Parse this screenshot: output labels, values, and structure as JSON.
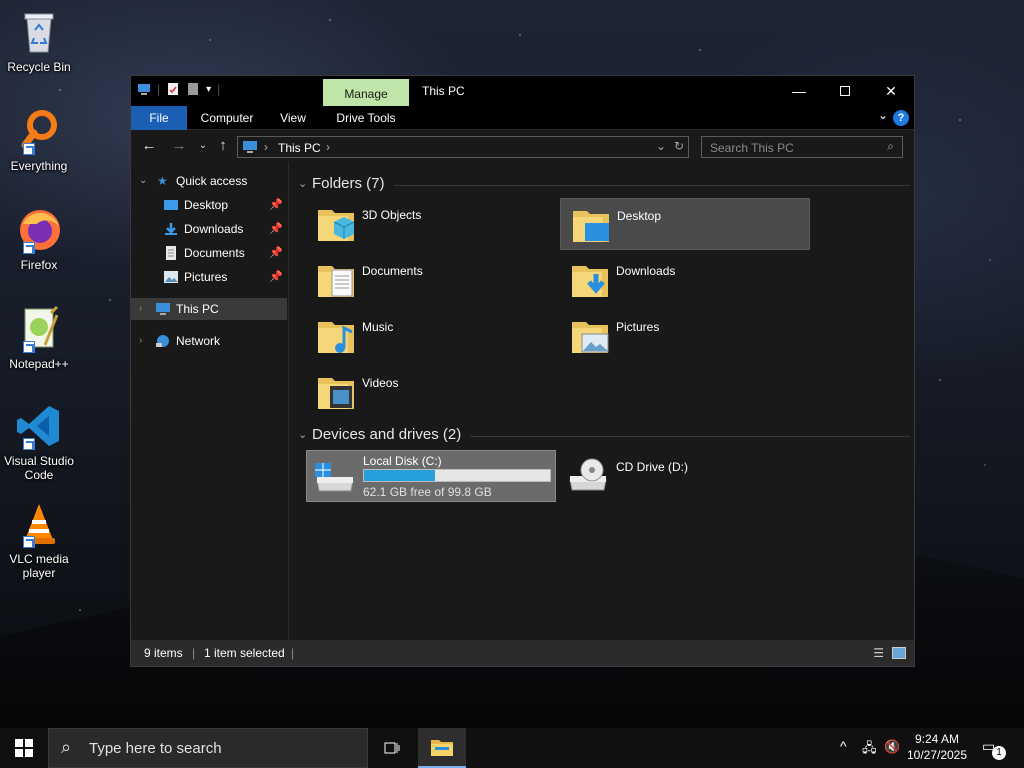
{
  "desktop": {
    "icons": [
      {
        "label": "Recycle Bin",
        "icon": "recycle-bin-icon"
      },
      {
        "label": "Everything",
        "icon": "everything-search-icon"
      },
      {
        "label": "Firefox",
        "icon": "firefox-icon"
      },
      {
        "label": "Notepad++",
        "icon": "notepad-plus-plus-icon"
      },
      {
        "label": "Visual Studio Code",
        "icon": "vscode-icon"
      },
      {
        "label": "VLC media player",
        "icon": "vlc-icon"
      }
    ]
  },
  "window": {
    "title": "This PC",
    "manage_tab": "Manage",
    "ribbon_tabs": [
      "File",
      "Computer",
      "View",
      "Drive Tools"
    ],
    "help_glyph": "?",
    "address": {
      "location": "This PC"
    },
    "search": {
      "placeholder": "Search This PC"
    },
    "nav": {
      "quick_access": "Quick access",
      "pinned": [
        "Desktop",
        "Downloads",
        "Documents",
        "Pictures"
      ],
      "this_pc": "This PC",
      "network": "Network"
    },
    "folders_header": "Folders (7)",
    "folders": [
      "3D Objects",
      "Desktop",
      "Documents",
      "Downloads",
      "Music",
      "Pictures",
      "Videos"
    ],
    "devices_header": "Devices and drives (2)",
    "drives": [
      {
        "name": "Local Disk (C:)",
        "usage": "62.1 GB free of 99.8 GB",
        "used_fraction": 0.38
      },
      {
        "name": "CD Drive (D:)"
      }
    ],
    "status": {
      "items": "9 items",
      "selected": "1 item selected"
    },
    "colors": {
      "accent": "#1a5fb4",
      "manage": "#bfe6a8",
      "bar_fill": "#26a0da"
    }
  },
  "taskbar": {
    "search_placeholder": "Type here to search",
    "time": "9:24 AM",
    "date": "10/27/2025",
    "notification_count": "1"
  }
}
